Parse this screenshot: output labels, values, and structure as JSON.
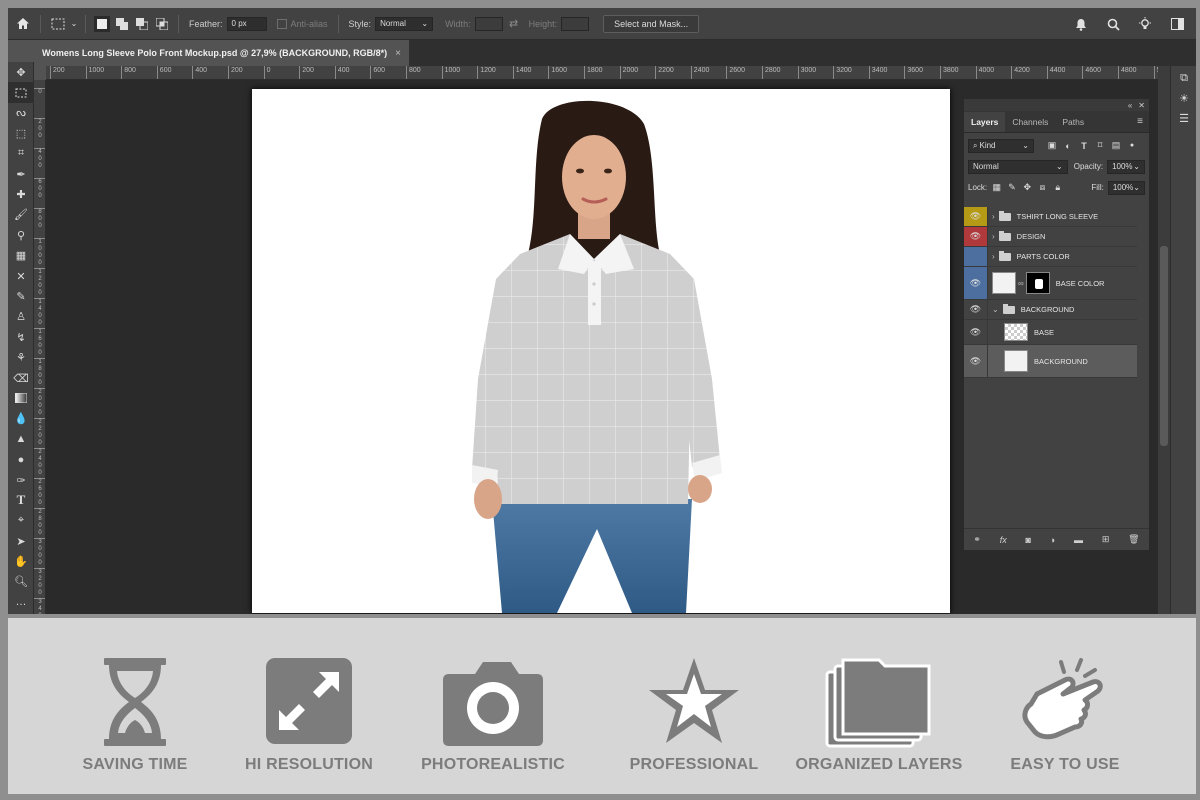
{
  "options_bar": {
    "feather_label": "Feather:",
    "feather_value": "0 px",
    "antialias_label": "Anti-alias",
    "style_label": "Style:",
    "style_value": "Normal",
    "width_label": "Width:",
    "height_label": "Height:",
    "select_mask_label": "Select and Mask..."
  },
  "document": {
    "tab_title": "Womens Long Sleeve Polo Front Mockup.psd @ 27,9% (BACKGROUND, RGB/8*)",
    "close": "×"
  },
  "ruler": {
    "h_ticks": [
      "200",
      "1000",
      "800",
      "600",
      "400",
      "200",
      "0",
      "200",
      "400",
      "600",
      "800",
      "1000",
      "1200",
      "1400",
      "1600",
      "1800",
      "2000",
      "2200",
      "2400",
      "2600",
      "2800",
      "3000",
      "3200",
      "3400",
      "3600",
      "3800",
      "4000",
      "4200",
      "4400",
      "4600",
      "4800",
      "5000"
    ],
    "v_ticks": [
      "0",
      "2 0 0",
      "4 0 0",
      "6 0 0",
      "8 0 0",
      "1 0 0 0",
      "1 2 0 0",
      "1 4 0 0",
      "1 6 0 0",
      "1 8 0 0",
      "2 0 0 0",
      "2 2 0 0",
      "2 4 0 0",
      "2 6 0 0",
      "2 8 0 0",
      "3 0 0 0",
      "3 2 0 0",
      "3 4 0 0"
    ]
  },
  "layers_panel": {
    "tabs": [
      "Layers",
      "Channels",
      "Paths"
    ],
    "filter_value": "Kind",
    "blend_value": "Normal",
    "opacity_label": "Opacity:",
    "opacity_value": "100%",
    "lock_label": "Lock:",
    "fill_label": "Fill:",
    "fill_value": "100%",
    "layers": [
      {
        "name": "TSHIRT LONG SLEEVE",
        "color": "#b59a16"
      },
      {
        "name": "DESIGN",
        "color": "#b0393b"
      },
      {
        "name": "PARTS COLOR",
        "color": "#4d6fa0"
      },
      {
        "name": "BASE COLOR",
        "color": "#4d6fa0"
      },
      {
        "name": "BACKGROUND",
        "color": ""
      },
      {
        "name": "BASE",
        "color": ""
      },
      {
        "name": "BACKGROUND",
        "color": ""
      }
    ]
  },
  "features": [
    {
      "label": "SAVING TIME",
      "icon": "hourglass-icon"
    },
    {
      "label": "HI RESOLUTION",
      "icon": "expand-arrows-icon"
    },
    {
      "label": "PHOTOREALISTIC",
      "icon": "camera-icon"
    },
    {
      "label": "PROFESSIONAL",
      "icon": "star-icon"
    },
    {
      "label": "ORGANIZED LAYERS",
      "icon": "stacked-layers-icon"
    },
    {
      "label": "EASY TO USE",
      "icon": "tap-hand-icon"
    }
  ],
  "colors": {
    "feature_gray": "#7c7c7c",
    "panel": "#424242",
    "canvas_bg": "#2a2a2a"
  }
}
